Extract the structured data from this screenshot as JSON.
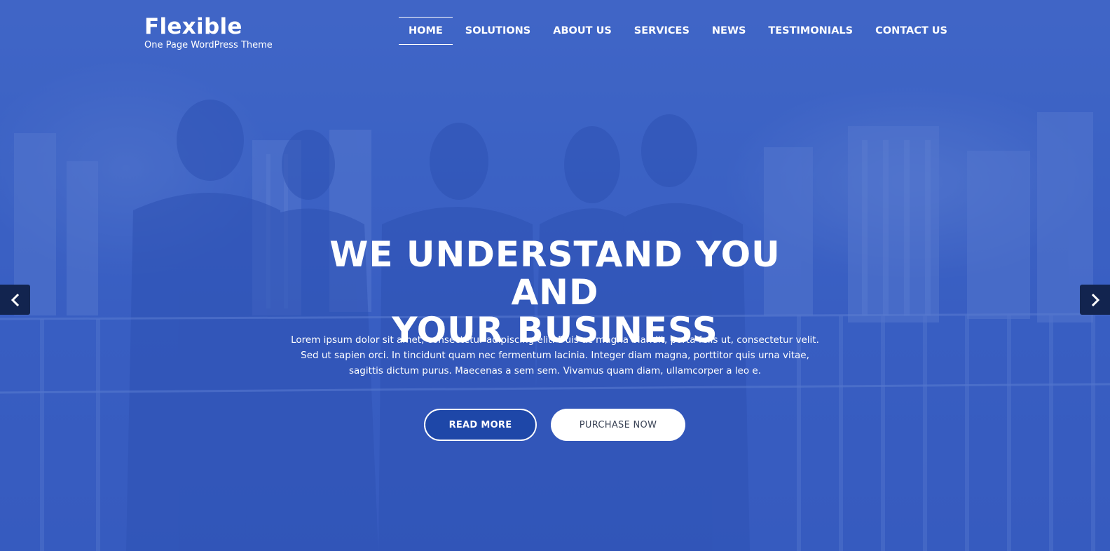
{
  "brand": {
    "title": "Flexible",
    "tagline": "One Page WordPress Theme"
  },
  "nav": {
    "items": [
      {
        "label": "HOME",
        "active": true
      },
      {
        "label": "SOLUTIONS",
        "active": false
      },
      {
        "label": "ABOUT US",
        "active": false
      },
      {
        "label": "SERVICES",
        "active": false
      },
      {
        "label": "NEWS",
        "active": false
      },
      {
        "label": "TESTIMONIALS",
        "active": false
      },
      {
        "label": "CONTACT US",
        "active": false
      }
    ]
  },
  "hero": {
    "title_line1": "WE UNDERSTAND YOU AND",
    "title_line2": "YOUR BUSINESS",
    "text": "Lorem ipsum dolor sit amet, consectetur adipiscing elit. Duis ac magna blandit, porta felis ut, consectetur velit. Sed ut sapien orci. In tincidunt quam nec fermentum lacinia. Integer diam magna, porttitor quis urna vitae, sagittis dictum purus. Maecenas a sem sem. Vivamus quam diam, ullamcorper a leo e.",
    "read_more_label": "READ MORE",
    "purchase_label": "PURCHASE NOW"
  },
  "slider": {
    "prev_icon": "chevron-left-icon",
    "next_icon": "chevron-right-icon"
  },
  "colors": {
    "overlay": "#3058c4",
    "read_more_bg": "#1e47a8",
    "arrow_bg": "#12244f"
  }
}
